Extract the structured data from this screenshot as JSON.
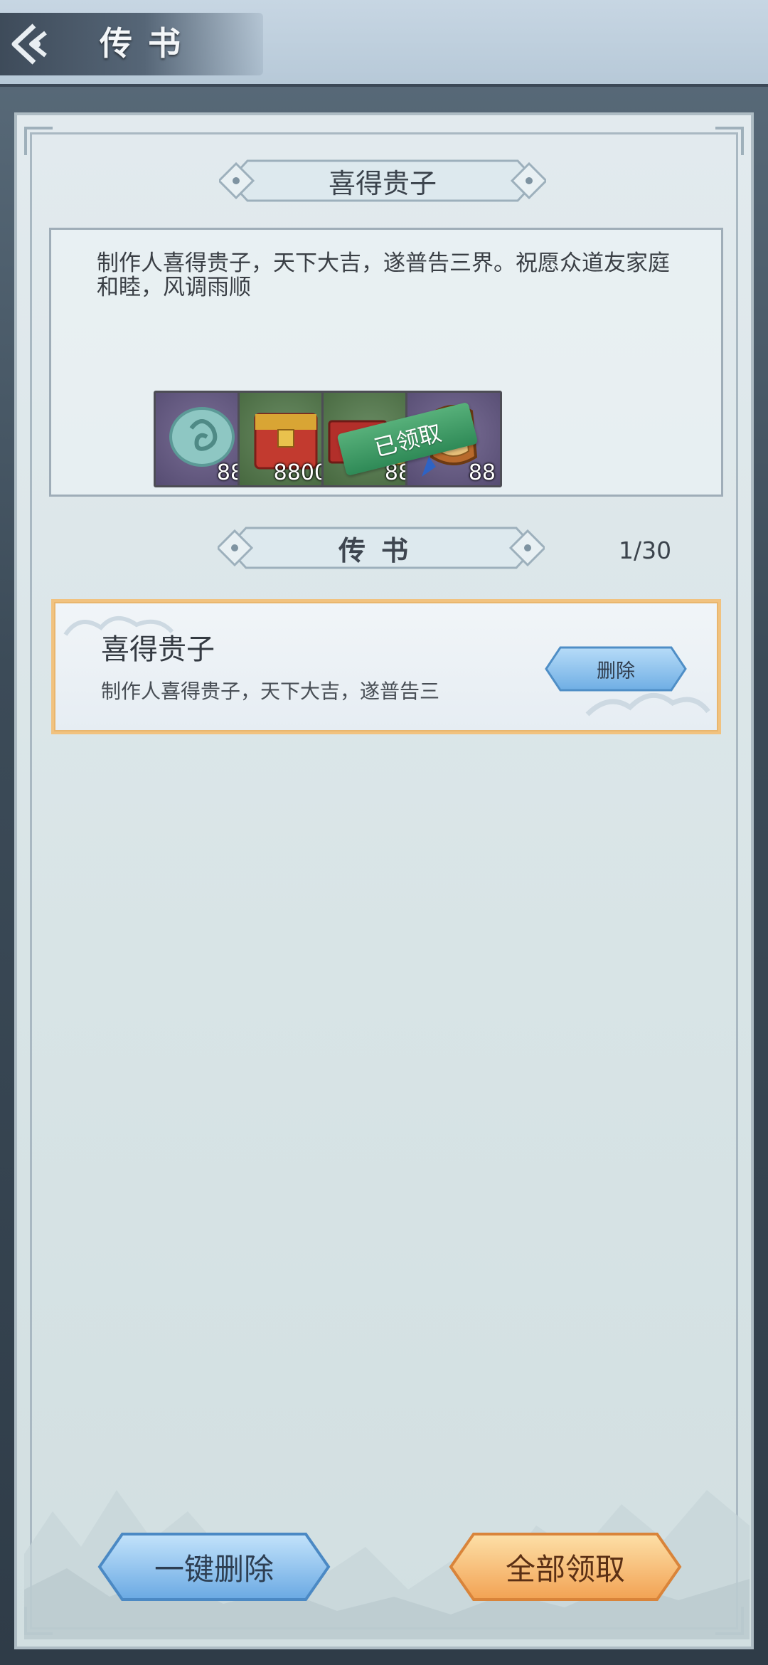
{
  "header": {
    "title": "传书"
  },
  "mail_detail": {
    "title": "喜得贵子",
    "body": "制作人喜得贵子，天下大吉，遂普告三界。祝愿众道友家庭和睦，风调雨顺",
    "claimed_label": "已领取",
    "items": [
      {
        "icon": "jade-pendant-icon",
        "qty": "88"
      },
      {
        "icon": "red-chest-icon",
        "qty": "8800"
      },
      {
        "icon": "card-box-icon",
        "qty": "88"
      },
      {
        "icon": "bronze-token-icon",
        "qty": "88"
      }
    ]
  },
  "mail_list": {
    "section_title": "传书",
    "counter": "1/30",
    "items": [
      {
        "title": "喜得贵子",
        "preview": "制作人喜得贵子，天下大吉，遂普告三",
        "delete_label": "删除"
      }
    ]
  },
  "footer": {
    "delete_all_label": "一键删除",
    "claim_all_label": "全部领取"
  },
  "colors": {
    "frame_border": "#aebcc4",
    "card_border": "#f1c27f",
    "blue_button": "#8cc2ee",
    "orange_button": "#f6b46a",
    "claimed_stamp": "#3d9a63"
  }
}
